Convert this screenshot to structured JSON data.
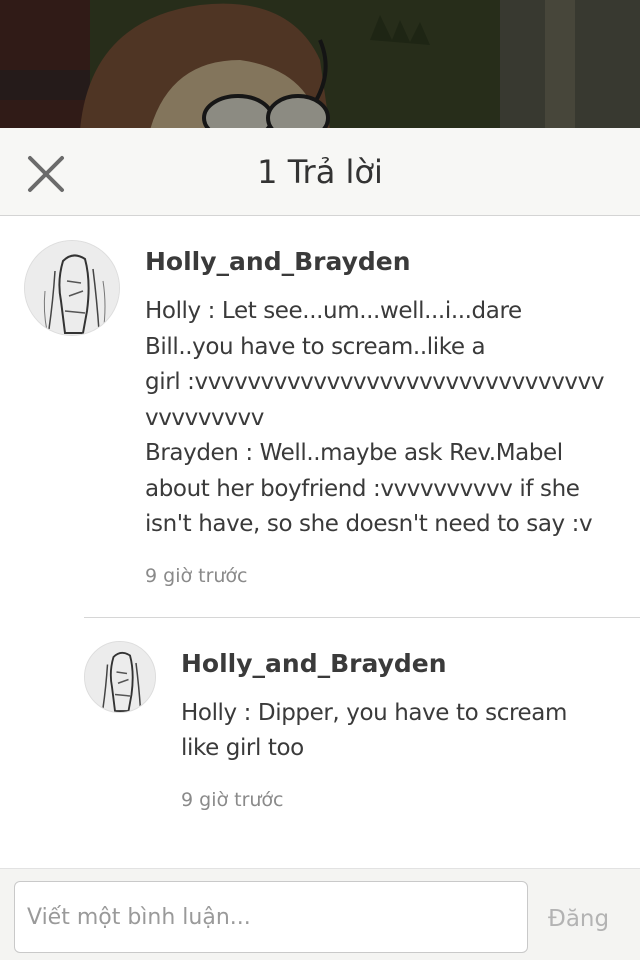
{
  "header": {
    "title": "1 Trả lời",
    "close_icon": "close-icon"
  },
  "comment": {
    "username": "Holly_and_Brayden",
    "text": "Holly : Let see...um...well...i...dare\nBill..you have to scream..like a\ngirl :vvvvvvvvvvvvvvvvvvvvvvvvvvvvvvv\nvvvvvvvvv\nBrayden : Well..maybe ask Rev.Mabel\nabout her boyfriend :vvvvvvvvvv if she\nisn't have, so she doesn't need to say :v",
    "timestamp": "9 giờ trước"
  },
  "reply": {
    "username": "Holly_and_Brayden",
    "text": "Holly : Dipper, you have to scream\nlike girl too",
    "timestamp": "9 giờ trước"
  },
  "composer": {
    "placeholder": "Viết một bình luận...",
    "post_label": "Đăng"
  },
  "colors": {
    "text": "#3a3a3a",
    "muted": "#8a8a8a",
    "disabled_button": "#b3b3b3",
    "header_bg": "#f7f7f5"
  }
}
